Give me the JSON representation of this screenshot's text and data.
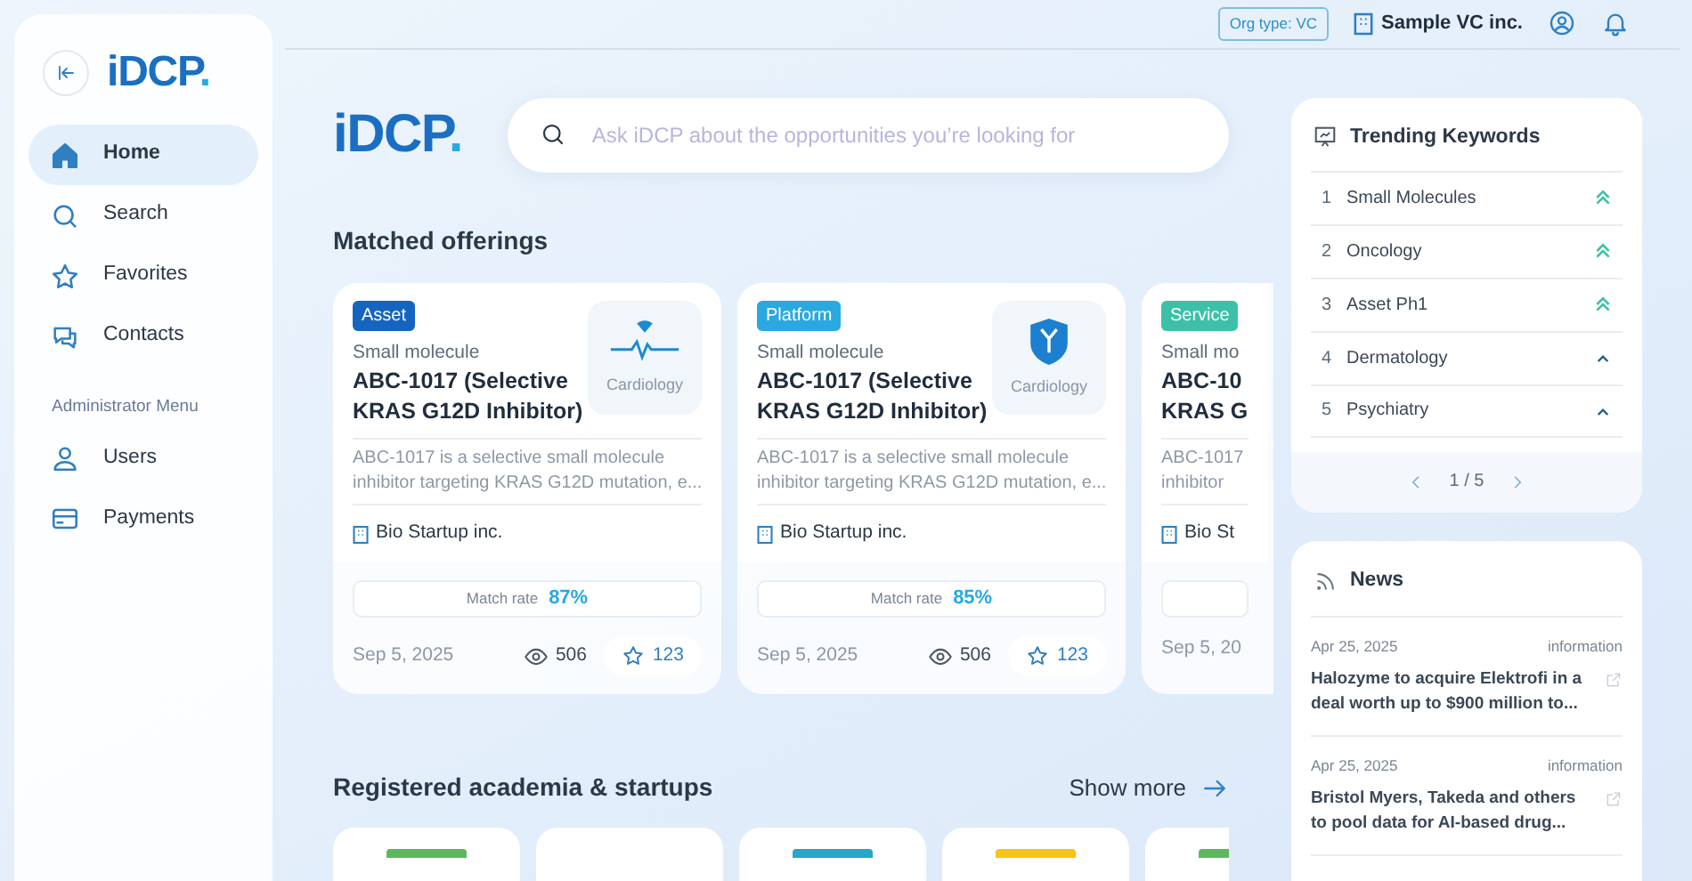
{
  "sidebar": {
    "logo": "iDCP",
    "logo_dot": ".",
    "nav": [
      {
        "kind": "home",
        "label": "Home",
        "selected": true
      },
      {
        "kind": "search",
        "label": "Search",
        "selected": false
      },
      {
        "kind": "star",
        "label": "Favorites",
        "selected": false
      },
      {
        "kind": "chat",
        "label": "Contacts",
        "selected": false
      }
    ],
    "admin_heading": "Administrator Menu",
    "admin_nav": [
      {
        "kind": "user",
        "label": "Users",
        "selected": false
      },
      {
        "kind": "card",
        "label": "Payments",
        "selected": false
      }
    ]
  },
  "header": {
    "org_type": "Org type: VC",
    "org_name": "Sample VC inc."
  },
  "hero": {
    "logo": "iDCP",
    "logo_dot": ".",
    "search_placeholder": "Ask iDCP about the opportunities you’re looking for"
  },
  "matched": {
    "title": "Matched offerings",
    "cards": [
      {
        "tag": "Asset",
        "color": "#1565c0",
        "subtitle": "Small molecule",
        "title_lines": [
          "ABC-1017 (Selective",
          "KRAS G12D Inhibitor)"
        ],
        "kind": "pulse",
        "area": "Cardiology",
        "desc_lines": [
          "ABC-1017 is a selective small molecule",
          "inhibitor targeting KRAS G12D mutation, e..."
        ],
        "company": "Bio Startup inc.",
        "match_label": "Match rate",
        "match": "87%",
        "date": "Sep 5, 2025",
        "views": "506",
        "stars": "123"
      },
      {
        "tag": "Platform",
        "color": "#29a9e0",
        "subtitle": "Small molecule",
        "title_lines": [
          "ABC-1017 (Selective",
          "KRAS G12D Inhibitor)"
        ],
        "kind": "shield",
        "area": "Cardiology",
        "desc_lines": [
          "ABC-1017 is a selective small molecule",
          "inhibitor targeting KRAS G12D mutation, e..."
        ],
        "company": "Bio Startup inc.",
        "match_label": "Match rate",
        "match": "85%",
        "date": "Sep 5, 2025",
        "views": "506",
        "stars": "123"
      },
      {
        "tag": "Service",
        "color": "#3cc1a8",
        "subtitle": "Small mo",
        "title_lines": [
          "ABC-10",
          "KRAS G"
        ],
        "desc_lines": [
          "ABC-1017",
          "inhibitor"
        ],
        "company": "Bio St",
        "date": "Sep 5, 20"
      }
    ]
  },
  "registered": {
    "title": "Registered academia & startups",
    "show_more": "Show more",
    "cards": [
      {
        "kind": "logo",
        "color": "#5cb85c"
      },
      {
        "kind": "plain"
      },
      {
        "kind": "logo",
        "color": "#26a6c9"
      },
      {
        "kind": "logo",
        "color": "#f5c518"
      },
      {
        "kind": "logo",
        "color": "#5cb85c"
      }
    ]
  },
  "trending": {
    "title": "Trending Keywords",
    "items": [
      {
        "rank": "1",
        "label": "Small Molecules",
        "kind": "strong"
      },
      {
        "rank": "2",
        "label": "Oncology",
        "kind": "strong"
      },
      {
        "rank": "3",
        "label": "Asset Ph1",
        "kind": "strong"
      },
      {
        "rank": "4",
        "label": "Dermatology",
        "kind": "up"
      },
      {
        "rank": "5",
        "label": "Psychiatry",
        "kind": "up"
      }
    ],
    "page": "1 / 5"
  },
  "news": {
    "title": "News",
    "items": [
      {
        "date": "Apr 25, 2025",
        "category": "information",
        "headline_lines": [
          "Halozyme to acquire Elektrofi in a",
          "deal worth up to $900 million to..."
        ]
      },
      {
        "date": "Apr 25, 2025",
        "category": "information",
        "headline_lines": [
          "Bristol Myers, Takeda and others",
          "to pool data for AI-based drug..."
        ]
      }
    ]
  }
}
